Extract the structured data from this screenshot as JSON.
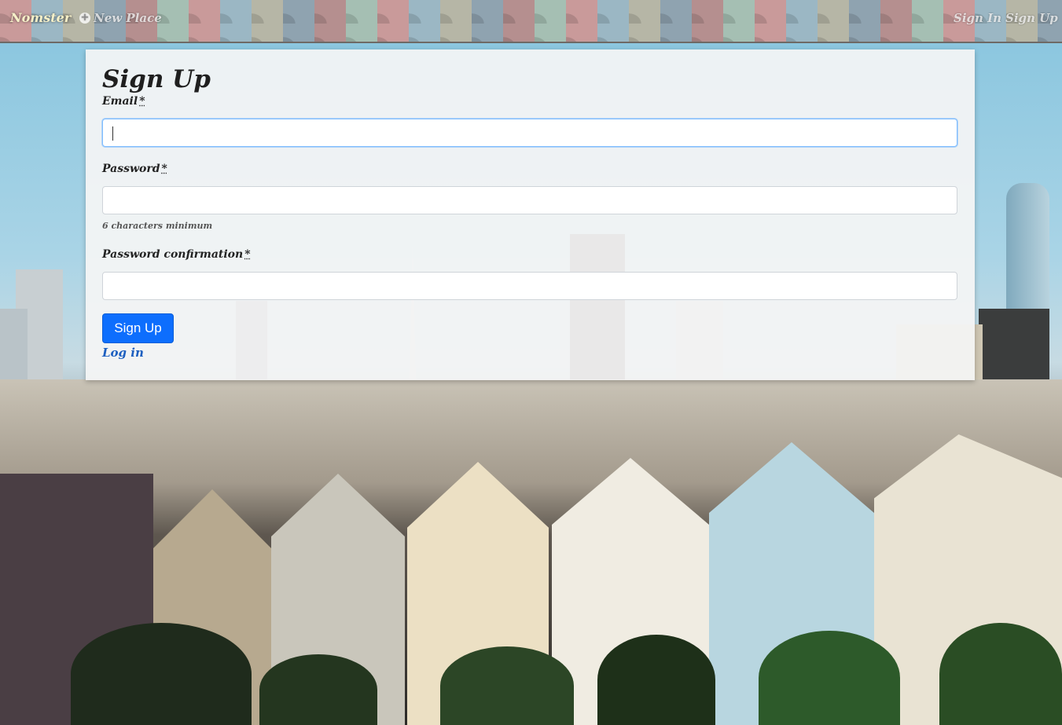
{
  "nav": {
    "brand": "Nomster",
    "new_place": "New Place",
    "new_place_icon": "plus-circle-icon",
    "sign_in": "Sign In",
    "sign_up": "Sign Up"
  },
  "form": {
    "title": "Sign Up",
    "email_label": "Email",
    "password_label": "Password",
    "password_hint": "6 characters minimum",
    "password_confirmation_label": "Password confirmation",
    "required_marker": "*",
    "email_value": "",
    "password_value": "",
    "password_confirmation_value": "",
    "submit_label": "Sign Up",
    "login_link": "Log in"
  },
  "colors": {
    "primary_button": "#0d6efd",
    "link": "#1d5fc0"
  }
}
